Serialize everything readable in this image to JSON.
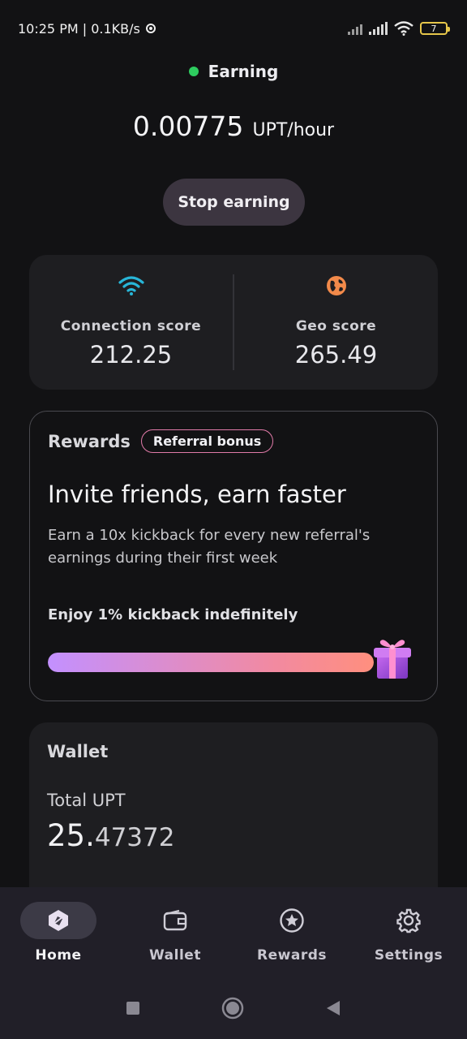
{
  "status_bar": {
    "time_speed": "10:25 PM | 0.1KB/s",
    "battery": "7"
  },
  "earning": {
    "status_label": "Earning",
    "status_color": "#2ecc5f",
    "rate_value": "0.00775",
    "rate_unit": "UPT/hour",
    "stop_label": "Stop earning"
  },
  "scores": {
    "connection_label": "Connection score",
    "connection_value": "212.25",
    "geo_label": "Geo score",
    "geo_value": "265.49"
  },
  "rewards": {
    "title": "Rewards",
    "badge": "Referral bonus",
    "headline": "Invite friends, earn faster",
    "description": "Earn a 10x kickback for every new referral's earnings during their first week",
    "enjoy": "Enjoy 1% kickback indefinitely",
    "progress_percent": 100
  },
  "wallet": {
    "title": "Wallet",
    "total_label": "Total UPT",
    "amount_int": "25.",
    "amount_dec": "47372"
  },
  "bottom_nav": {
    "items": [
      {
        "label": "Home",
        "icon": "home-icon",
        "active": true
      },
      {
        "label": "Wallet",
        "icon": "wallet-icon",
        "active": false
      },
      {
        "label": "Rewards",
        "icon": "star-icon",
        "active": false
      },
      {
        "label": "Settings",
        "icon": "gear-icon",
        "active": false
      }
    ]
  }
}
